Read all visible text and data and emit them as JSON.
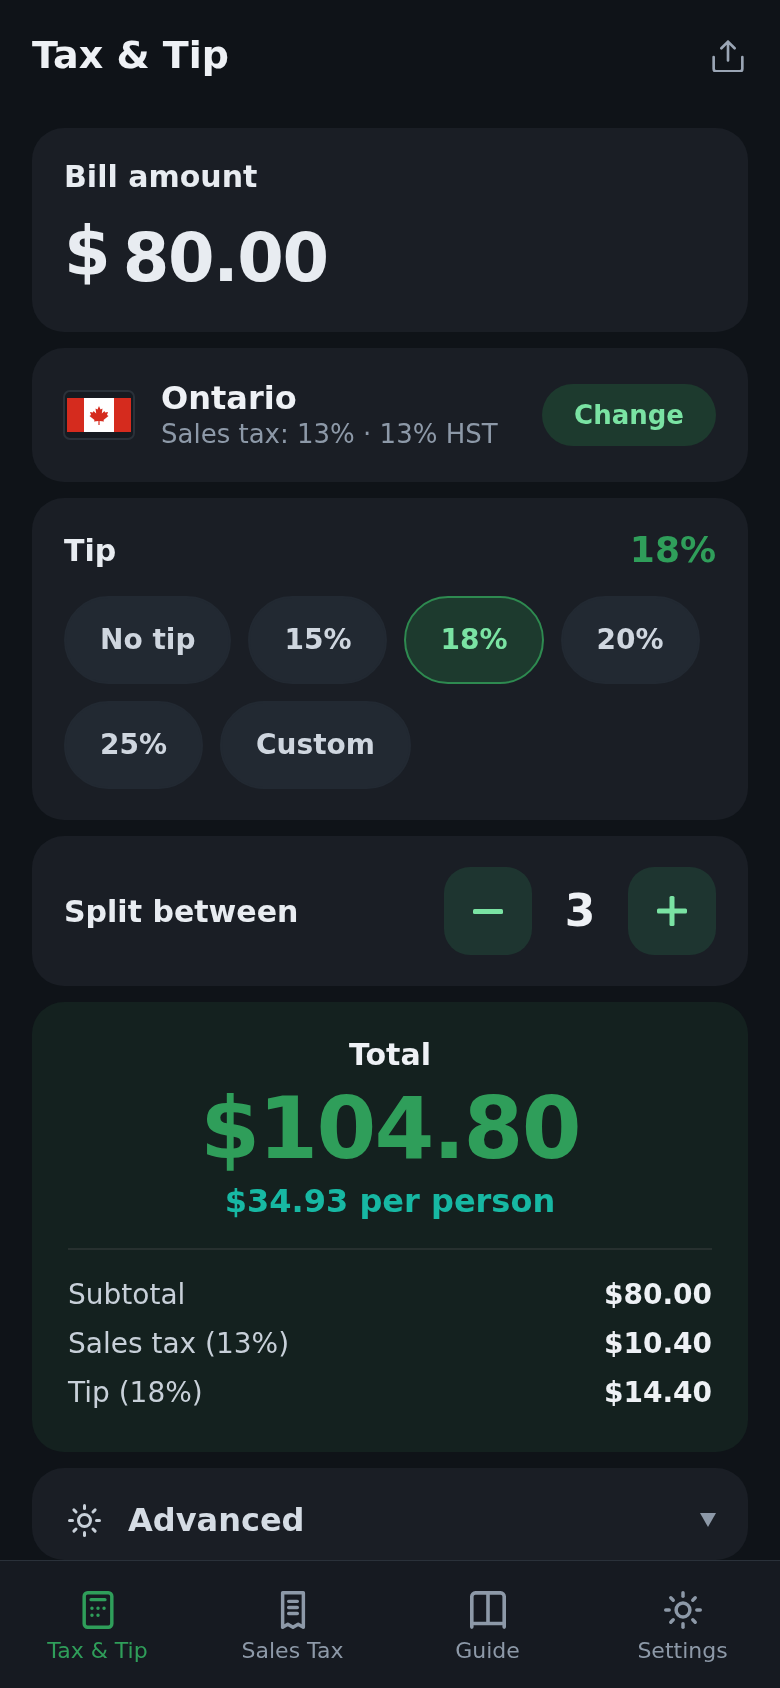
{
  "header": {
    "title": "Tax & Tip"
  },
  "bill": {
    "label": "Bill amount",
    "currency": "$",
    "value": "80.00"
  },
  "region": {
    "name": "Ontario",
    "detail": "Sales tax: 13% · 13% HST",
    "action": "Change"
  },
  "tip": {
    "label": "Tip",
    "current": "18%",
    "options": [
      {
        "label": "No tip",
        "selected": false
      },
      {
        "label": "15%",
        "selected": false
      },
      {
        "label": "18%",
        "selected": true
      },
      {
        "label": "20%",
        "selected": false
      },
      {
        "label": "25%",
        "selected": false
      },
      {
        "label": "Custom",
        "selected": false
      }
    ]
  },
  "split": {
    "label": "Split between",
    "count": "3"
  },
  "total": {
    "label": "Total",
    "amount": "$104.80",
    "per_person": "$34.93 per person",
    "rows": [
      {
        "label": "Subtotal",
        "value": "$80.00"
      },
      {
        "label": "Sales tax (13%)",
        "value": "$10.40"
      },
      {
        "label": "Tip (18%)",
        "value": "$14.40"
      }
    ]
  },
  "advanced": {
    "label": "Advanced",
    "expanded": false
  },
  "tab_bar": {
    "items": [
      {
        "label": "Tax & Tip",
        "selected": true
      },
      {
        "label": "Sales Tax",
        "selected": false
      },
      {
        "label": "Guide",
        "selected": false
      },
      {
        "label": "Settings",
        "selected": false
      }
    ]
  }
}
